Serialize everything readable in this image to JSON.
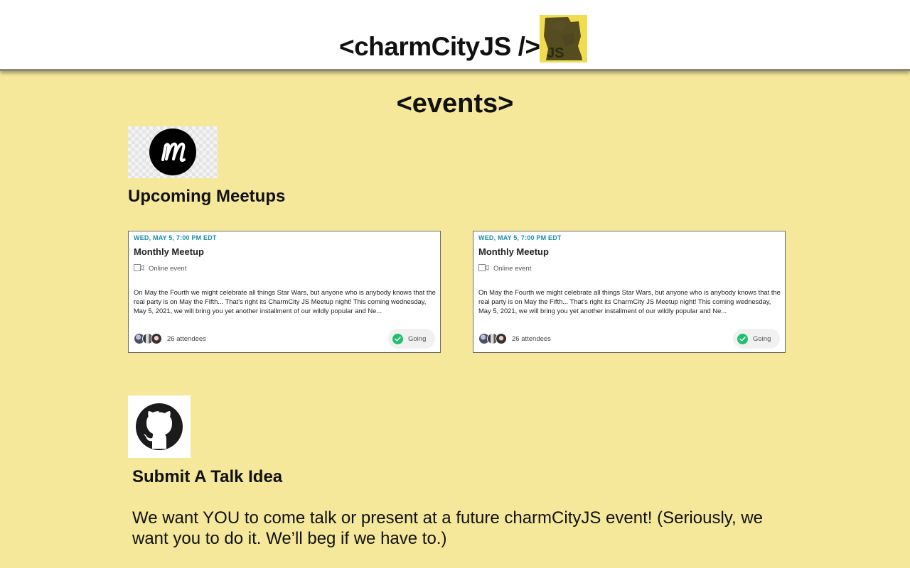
{
  "header": {
    "brand": "<charmCityJS />",
    "logo_text": "JS"
  },
  "events": {
    "heading": "<events>"
  },
  "meetups": {
    "heading": "Upcoming Meetups",
    "cards": [
      {
        "date": "WED, MAY 5, 7:00 PM EDT",
        "title": "Monthly Meetup",
        "location": "Online event",
        "description": "On May the Fourth we might celebrate all things Star Wars, but anyone who is anybody knows that the real party is on May the Fifth... That's right its CharmCity JS Meetup night! This coming wednesday, May 5, 2021, we will bring you yet another installment of our wildly popular and Ne...",
        "attendees": "26 attendees",
        "rsvp": "Going"
      },
      {
        "date": "WED, MAY 5, 7:00 PM EDT",
        "title": "Monthly Meetup",
        "location": "Online event",
        "description": "On May the Fourth we might celebrate all things Star Wars, but anyone who is anybody knows that the real party is on May the Fifth... That's right its CharmCity JS Meetup night! This coming wednesday, May 5, 2021, we will bring you yet another installment of our wildly popular and Ne...",
        "attendees": "26 attendees",
        "rsvp": "Going"
      }
    ]
  },
  "talk": {
    "heading": "Submit A Talk Idea",
    "body": "We want YOU to come talk or present at a future charmCityJS event! (Seriously, we want you to do it. We’ll beg if we have to.)"
  },
  "colors": {
    "page_background": "#f5e89a",
    "js_yellow": "#f0dc4e",
    "date_teal": "#1a8ca8",
    "going_green": "#1fbf6f"
  },
  "icons": {
    "brand_logo": "baltimore-map-js-logo",
    "meetup": "meetup-m-logo",
    "github": "github-octocat-icon",
    "online": "video-camera-icon",
    "going": "check-circle-icon"
  }
}
